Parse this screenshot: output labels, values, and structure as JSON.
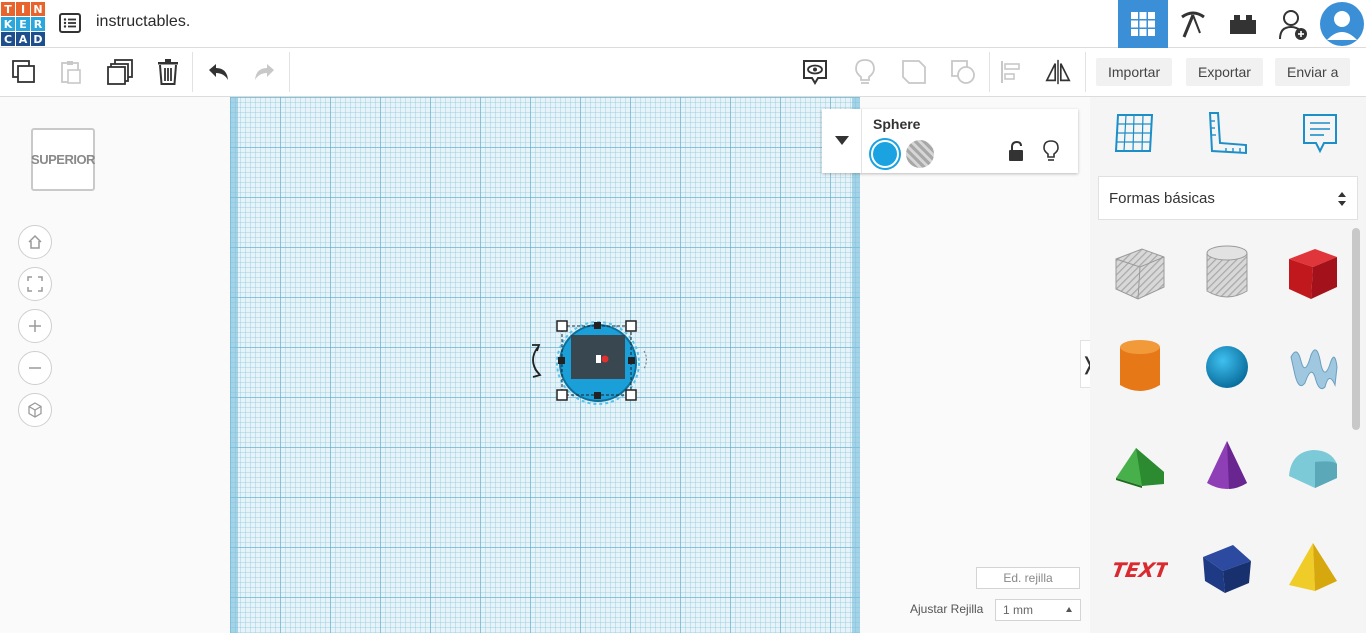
{
  "logo": {
    "letters": [
      "T",
      "I",
      "N",
      "K",
      "E",
      "R",
      "C",
      "A",
      "D"
    ],
    "colors": [
      "#e8642c",
      "#e8642c",
      "#e8642c",
      "#2aa7dc",
      "#2aa7dc",
      "#2aa7dc",
      "#1e4f8c",
      "#1e4f8c",
      "#1e4f8c"
    ]
  },
  "app": {
    "title": "instructables."
  },
  "topbar": {
    "icons": [
      "3d-design-grid-icon",
      "codeblocks-pickaxe-icon",
      "bricks-icon",
      "add-user-icon",
      "user-avatar-icon"
    ],
    "accent": "#3a8fd6"
  },
  "toolbar": {
    "import_label": "Importar",
    "export_label": "Exportar",
    "send_label": "Enviar a",
    "icons": [
      "copy-icon",
      "paste-icon",
      "duplicate-icon",
      "delete-icon",
      "undo-icon",
      "redo-icon",
      "notes-eye-icon",
      "light-icon",
      "group-icon",
      "ungroup-icon",
      "align-icon",
      "mirror-icon"
    ]
  },
  "viewcube": {
    "label": "SUPERIOR"
  },
  "nav": {
    "icons": [
      "home-icon",
      "fit-view-icon",
      "zoom-in-icon",
      "zoom-out-icon",
      "perspective-icon"
    ]
  },
  "inspector": {
    "shape_name": "Sphere",
    "solid_color": "#1aa3e0",
    "hole_color": "#b5b5b5"
  },
  "workplane": {
    "grid_edit_label": "Ed. rejilla",
    "snap_label": "Ajustar Rejilla",
    "snap_value": "1 mm",
    "grid_color": "#e6f3f8"
  },
  "library": {
    "category": "Formas básicas",
    "icons": [
      "workplane-icon",
      "ruler-icon",
      "notes-icon"
    ],
    "shapes": [
      "box-hole",
      "cylinder-hole",
      "box",
      "cylinder",
      "sphere",
      "scribble",
      "roof",
      "cone",
      "round-roof",
      "text",
      "half-sphere-prism",
      "pyramid"
    ]
  }
}
